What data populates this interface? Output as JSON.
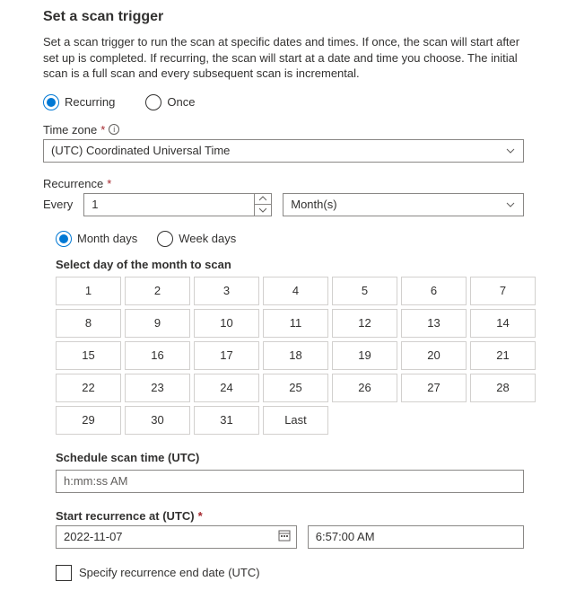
{
  "title": "Set a scan trigger",
  "description": "Set a scan trigger to run the scan at specific dates and times. If once, the scan will start after set up is completed. If recurring, the scan will start at a date and time you choose. The initial scan is a full scan and every subsequent scan is incremental.",
  "trigger_type": {
    "recurring_label": "Recurring",
    "once_label": "Once",
    "selected": "recurring"
  },
  "timezone": {
    "label": "Time zone",
    "value": "(UTC) Coordinated Universal Time"
  },
  "recurrence": {
    "label": "Recurrence",
    "every_label": "Every",
    "every_value": "1",
    "unit_value": "Month(s)",
    "day_mode": {
      "month_days_label": "Month days",
      "week_days_label": "Week days",
      "selected": "month"
    },
    "select_day_label": "Select day of the month to scan",
    "days": [
      "1",
      "2",
      "3",
      "4",
      "5",
      "6",
      "7",
      "8",
      "9",
      "10",
      "11",
      "12",
      "13",
      "14",
      "15",
      "16",
      "17",
      "18",
      "19",
      "20",
      "21",
      "22",
      "23",
      "24",
      "25",
      "26",
      "27",
      "28",
      "29",
      "30",
      "31",
      "Last"
    ]
  },
  "schedule_time": {
    "label": "Schedule scan time (UTC)",
    "placeholder": "h:mm:ss AM"
  },
  "start_recurrence": {
    "label": "Start recurrence at (UTC)",
    "date_value": "2022-11-07",
    "time_value": "6:57:00 AM"
  },
  "end_date": {
    "label": "Specify recurrence end date (UTC)",
    "checked": false
  }
}
